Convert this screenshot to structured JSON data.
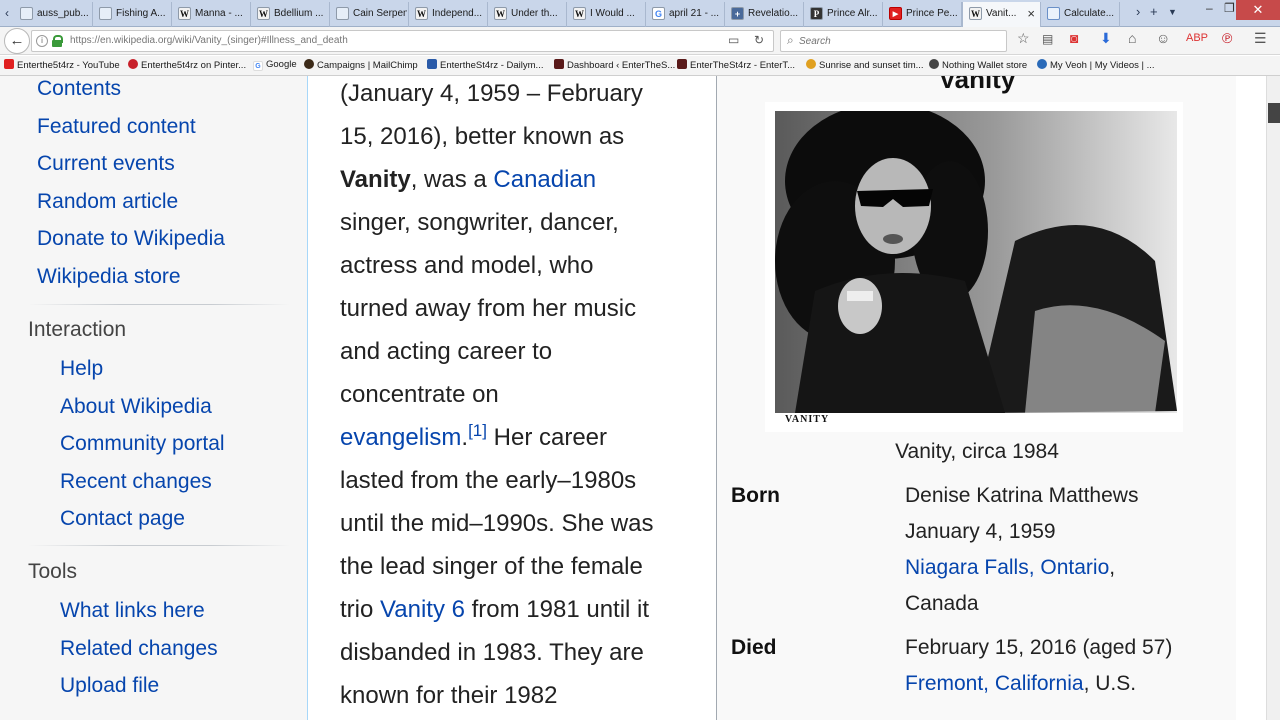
{
  "browser": {
    "tabs": [
      {
        "title": "auss_pub...",
        "icon": "document-icon",
        "kind": "plain",
        "glyph": ""
      },
      {
        "title": "Fishing A...",
        "icon": "document-icon",
        "kind": "plain",
        "glyph": ""
      },
      {
        "title": "Manna - ...",
        "icon": "wikipedia-icon",
        "kind": "wiki",
        "glyph": "W"
      },
      {
        "title": "Bdellium ...",
        "icon": "wikipedia-icon",
        "kind": "wiki",
        "glyph": "W"
      },
      {
        "title": "Cain Serpent ...",
        "icon": "document-icon",
        "kind": "plain",
        "glyph": ""
      },
      {
        "title": "Independ...",
        "icon": "wikipedia-icon",
        "kind": "wiki",
        "glyph": "W"
      },
      {
        "title": "Under th...",
        "icon": "wikipedia-icon",
        "kind": "wiki",
        "glyph": "W"
      },
      {
        "title": "I Would ...",
        "icon": "wikipedia-icon",
        "kind": "wiki",
        "glyph": "W"
      },
      {
        "title": "april 21 - ...",
        "icon": "google-icon",
        "kind": "g",
        "glyph": "G"
      },
      {
        "title": "Revelatio...",
        "icon": "revelation-icon",
        "kind": "rev",
        "glyph": "+"
      },
      {
        "title": "Prince Alr...",
        "icon": "prince-icon",
        "kind": "prince",
        "glyph": "P"
      },
      {
        "title": "Prince Pe...",
        "icon": "youtube-icon",
        "kind": "yt",
        "glyph": "▶"
      },
      {
        "title": "Vanit...",
        "icon": "wikipedia-icon",
        "kind": "wiki",
        "glyph": "W",
        "active": true
      },
      {
        "title": "Calculate...",
        "icon": "calculator-icon",
        "kind": "calc",
        "glyph": ""
      }
    ],
    "url": "https://en.wikipedia.org/wiki/Vanity_(singer)#Illness_and_death",
    "search_placeholder": "Search",
    "bookmarks": [
      {
        "label": "Enterthe5t4rz - YouTube",
        "icon": "youtube-icon",
        "cls": "yt"
      },
      {
        "label": "Enterthe5t4rz on Pinter...",
        "icon": "pinterest-icon",
        "cls": "pin"
      },
      {
        "label": "Google",
        "icon": "google-icon",
        "cls": "g"
      },
      {
        "label": "Campaigns | MailChimp",
        "icon": "mailchimp-icon",
        "cls": "mc"
      },
      {
        "label": "EntertheSt4rz - Dailym...",
        "icon": "dailymotion-icon",
        "cls": "dm"
      },
      {
        "label": "Dashboard ‹ EnterTheS...",
        "icon": "wordpress-icon",
        "cls": "wp"
      },
      {
        "label": "EnterTheSt4rz - EnterT...",
        "icon": "wordpress-icon",
        "cls": "wp"
      },
      {
        "label": "Sunrise and sunset tim...",
        "icon": "sun-icon",
        "cls": "sun"
      },
      {
        "label": "Nothing Wallet store",
        "icon": "store-icon",
        "cls": "nw"
      },
      {
        "label": "My Veoh | My Videos | ...",
        "icon": "veoh-icon",
        "cls": "veoh"
      }
    ]
  },
  "sidebar": {
    "nav_links": [
      "Contents",
      "Featured content",
      "Current events",
      "Random article",
      "Donate to Wikipedia",
      "Wikipedia store"
    ],
    "interaction_heading": "Interaction",
    "interaction_links": [
      "Help",
      "About Wikipedia",
      "Community portal",
      "Recent changes",
      "Contact page"
    ],
    "tools_heading": "Tools",
    "tools_links": [
      "What links here",
      "Related changes",
      "Upload file"
    ]
  },
  "article": {
    "lines": [
      "(January 4, 1959 – February",
      "15, 2016), better known as",
      "<b>Vanity</b>, was a <a>Canadian</a>",
      "singer, songwriter, dancer,",
      "actress and model, who",
      "turned away from her music",
      "and acting career to",
      "concentrate on",
      "<a>evangelism</a>.<sup>[1]</sup> Her career",
      "lasted from the early–1980s",
      "until the mid–1990s. She was",
      "the lead singer of the female",
      "trio <a>Vanity 6</a> from 1981 until it",
      "disbanded in 1983. They are",
      "known for their 1982"
    ]
  },
  "infobox": {
    "title": "Vanity",
    "photo_label": "VANITY",
    "caption": "Vanity, circa 1984",
    "born_label": "Born",
    "born_name": "Denise Katrina Matthews",
    "born_date": "January 4, 1959",
    "born_place_link": "Niagara Falls, Ontario",
    "born_country": "Canada",
    "died_label": "Died",
    "died_date": "February 15, 2016 (aged 57)",
    "died_place_link": "Fremont, California",
    "died_country": "U.S."
  }
}
